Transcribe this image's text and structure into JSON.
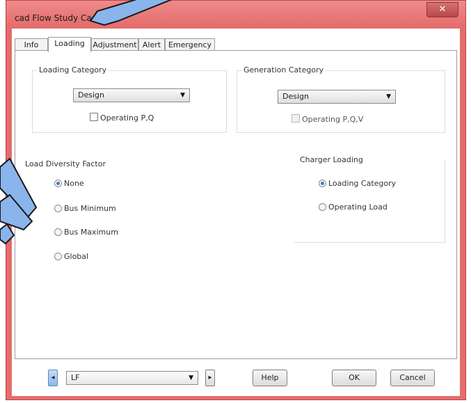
{
  "window": {
    "title": "cad Flow Study Case",
    "close_glyph": "✕"
  },
  "tabs": [
    {
      "label": "Info"
    },
    {
      "label": "Loading"
    },
    {
      "label": "Adjustment"
    },
    {
      "label": "Alert"
    },
    {
      "label": "Emergency"
    }
  ],
  "loading_category": {
    "legend": "Loading Category",
    "value": "Design",
    "checkbox_label": "Operating P,Q"
  },
  "generation_category": {
    "legend": "Generation Category",
    "value": "Design",
    "checkbox_label": "Operating P,Q,V"
  },
  "load_diversity": {
    "legend": "Load Diversity Factor",
    "options": [
      "None",
      "Bus Minimum",
      "Bus Maximum",
      "Global"
    ],
    "selected": "None"
  },
  "charger_loading": {
    "legend": "Charger Loading",
    "options": [
      "Loading Category",
      "Operating Load"
    ],
    "selected": "Loading Category"
  },
  "footer": {
    "config_value": "LF",
    "help_label": "Help",
    "ok_label": "OK",
    "cancel_label": "Cancel"
  },
  "icons": {
    "combo_arrow": "▼",
    "step_left": "◂",
    "step_right": "▸"
  },
  "colors": {
    "titlebar": "#e36b6b",
    "callout": "#8ab4ec"
  }
}
